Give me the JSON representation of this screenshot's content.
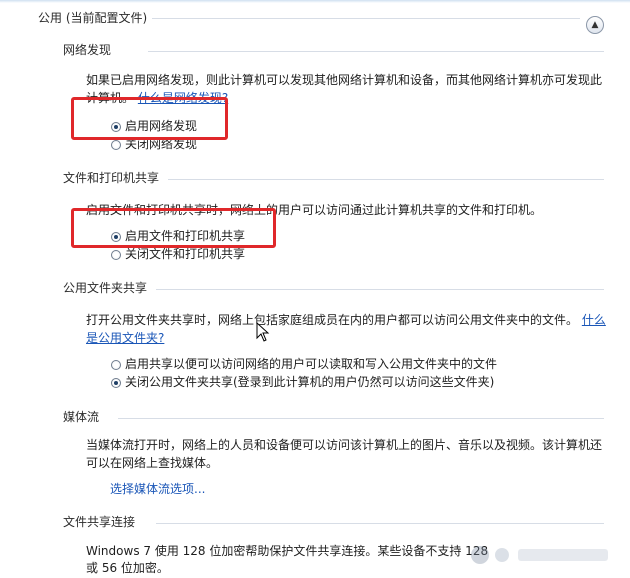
{
  "header": {
    "title": "公用 (当前配置文件)",
    "collapse_icon": "chevron-up-icon"
  },
  "network_discovery": {
    "title": "网络发现",
    "description_line1": "如果已启用网络发现，则此计算机可以发现其他网络计算机和设备，而其他网络计算机亦可发现此",
    "description_line2_prefix": "计算机。",
    "help_link": "什么是网络发现?",
    "options": [
      "启用网络发现",
      "关闭网络发现"
    ],
    "selected": "启用网络发现"
  },
  "file_printer_sharing": {
    "title": "文件和打印机共享",
    "description": "启用文件和打印机共享时，网络上的用户可以访问通过此计算机共享的文件和打印机。",
    "options": [
      "启用文件和打印机共享",
      "关闭文件和打印机共享"
    ],
    "selected": "启用文件和打印机共享"
  },
  "public_folder_sharing": {
    "title": "公用文件夹共享",
    "description_line1": "打开公用文件夹共享时，网络上包括家庭组成员在内的用户都可以访问公用文件夹中的文件。",
    "help_link_part1": "什么",
    "help_link_part2": "是公用文件夹?",
    "options": [
      "启用共享以便可以访问网络的用户可以读取和写入公用文件夹中的文件",
      "关闭公用文件夹共享(登录到此计算机的用户仍然可以访问这些文件夹)"
    ],
    "selected": "关闭公用文件夹共享(登录到此计算机的用户仍然可以访问这些文件夹)"
  },
  "media_streaming": {
    "title": "媒体流",
    "description_line1": "当媒体流打开时，网络上的人员和设备便可以访问该计算机上的图片、音乐以及视频。该计算机还",
    "description_line2": "可以在网络上查找媒体。",
    "link": "选择媒体流选项..."
  },
  "file_sharing_connections": {
    "title": "文件共享连接",
    "description_line1": "Windows 7 使用 128 位加密帮助保护文件共享连接。某些设备不支持 128",
    "description_line2": "或 56 位加密。"
  },
  "colors": {
    "highlight": "#e0282a",
    "link": "#1a56b7"
  }
}
